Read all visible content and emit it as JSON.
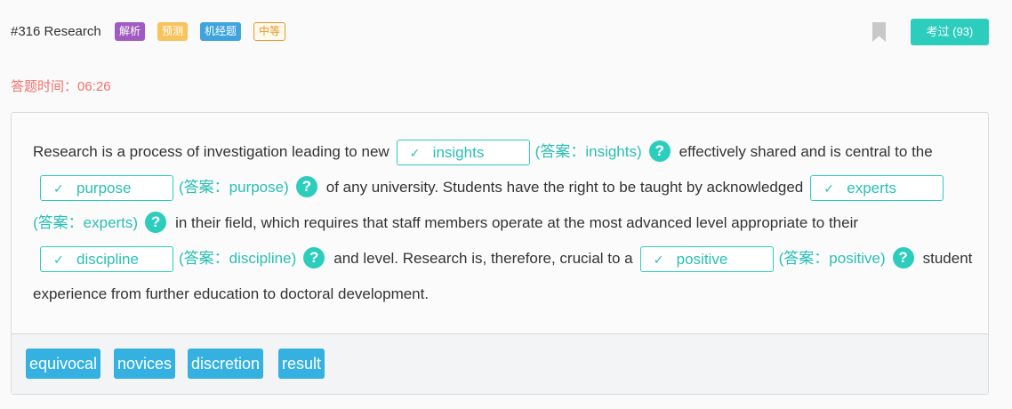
{
  "header": {
    "question_title": "#316 Research",
    "tags": [
      "解析",
      "预测",
      "机经题",
      "中等"
    ],
    "exam_button_label": "考过 (93)"
  },
  "timer": {
    "label": "答题时间：06:26"
  },
  "passage": {
    "text_1": "Research is a process of investigation leading to new",
    "blank_1_value": "insights",
    "answer_1": "(答案：insights)",
    "text_2": "effectively shared and is central to the",
    "blank_2_value": "purpose",
    "answer_2": "(答案：purpose)",
    "text_3": "of any university. Students have the right to be taught by acknowledged",
    "blank_3_value": "experts",
    "answer_3": "(答案：experts)",
    "text_4": "in their field, which requires that staff members operate at the most advanced level appropriate to their",
    "blank_4_value": "discipline",
    "answer_4": "(答案：discipline)",
    "text_5": "and level. Research is, therefore, crucial to a",
    "blank_5_value": "positive",
    "answer_5": "(答案：positive)",
    "text_6": "student experience from further education to doctoral development.",
    "check_glyph": "✓",
    "help_glyph": "?"
  },
  "options": [
    "equivocal",
    "novices",
    "discretion",
    "result"
  ],
  "colors": {
    "accent_teal": "#2dcdbd",
    "timer_red": "#f0726e",
    "chip_blue": "#35b1e1"
  }
}
